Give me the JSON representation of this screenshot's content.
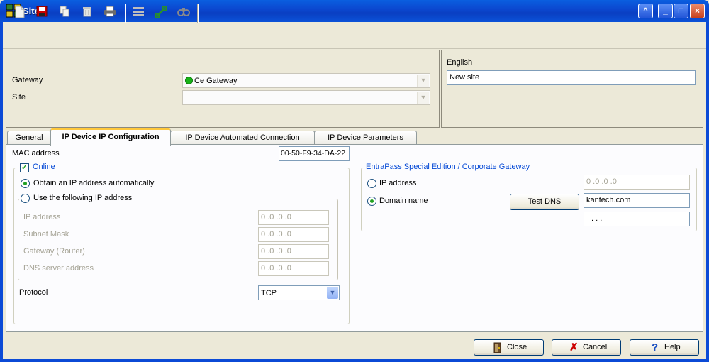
{
  "window": {
    "title": "Site",
    "icon": "app-grid-icon",
    "controls": [
      "help-icon",
      "minimize-icon",
      "maximize-icon",
      "close-icon"
    ]
  },
  "toolbar": {
    "buttons": [
      "new-icon",
      "save-icon",
      "copy-icon",
      "delete-icon",
      "print-icon",
      "list-icon",
      "link-icon",
      "find-icon"
    ]
  },
  "header": {
    "gateway_label": "Gateway",
    "gateway_value": "Ce Gateway",
    "gateway_status_color": "#18b318",
    "site_label": "Site",
    "site_value": "",
    "language_label": "English",
    "site_name_value": "New site"
  },
  "tabs": [
    {
      "label": "General",
      "active": false
    },
    {
      "label": "IP Device IP Configuration",
      "active": true
    },
    {
      "label": "IP Device Automated Connection",
      "active": false
    },
    {
      "label": "IP Device Parameters",
      "active": false
    }
  ],
  "ipconfig": {
    "mac_label": "MAC address",
    "mac_value": "00-50-F9-34-DA-22",
    "online_label": "Online",
    "online_checked": true,
    "obtain_auto_label": "Obtain an IP address automatically",
    "use_following_label": "Use the following IP address",
    "ip_label": "IP address",
    "ip_value": "0 .0 .0 .0",
    "subnet_label": "Subnet Mask",
    "subnet_value": "0 .0 .0 .0",
    "gateway_label": "Gateway (Router)",
    "gateway_value": "0 .0 .0 .0",
    "dns_label": "DNS server address",
    "dns_value": "0 .0 .0 .0",
    "protocol_label": "Protocol",
    "protocol_value": "TCP"
  },
  "entrapass": {
    "group_label": "EntraPass Special Edition / Corporate Gateway",
    "ip_label": "IP address",
    "ip_value": "0 .0 .0 .0",
    "domain_label": "Domain name",
    "domain_selected": true,
    "test_dns_label": "Test DNS",
    "domain_value": "kantech.com",
    "resolved_value": ".   .   ."
  },
  "footer": {
    "close_label": "Close",
    "cancel_label": "Cancel",
    "help_label": "Help"
  },
  "colors": {
    "titlebar": "#0b48d0",
    "accent_blue": "#0046d5",
    "tab_highlight": "#ffc83c",
    "radio_green": "#21a121"
  }
}
